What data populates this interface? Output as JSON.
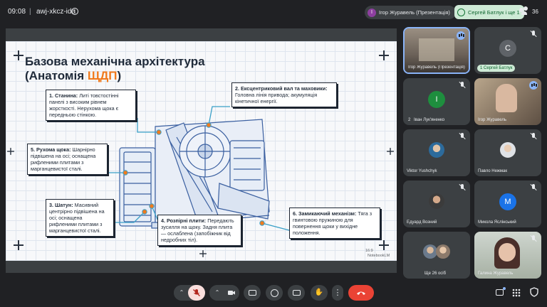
{
  "topbar": {
    "time": "09:08",
    "separator": "|",
    "meeting_code": "awj-xkcz-ida",
    "presenter": {
      "initial": "І",
      "label": "Ігор Журавель (Презентація)"
    },
    "host": {
      "label": "Сергей Батлук і ще 1"
    },
    "participants_count": "36"
  },
  "slide": {
    "title_line1": "Базова механічна архітектура",
    "title_line2_prefix": "(Анатомія ",
    "title_line2_accent": "ЩДП",
    "title_line2_suffix": ")",
    "callouts": [
      {
        "head": "1. Станина:",
        "body": " Литі товстостінні панелі з високим рівнем жорсткості. Нерухома щока є передньою стінкою."
      },
      {
        "head": "2. Ексцентриковий вал та маховики:",
        "body": " Головна лінія привода; акумуляція кінетичної енергії."
      },
      {
        "head": "5. Рухома щока:",
        "body": " Шарнірно підвішена на осі; оснащена рифленими плитами з марганцевистої сталі."
      },
      {
        "head": "3. Шатун:",
        "body": " Масивний центрірно підвішена на осі; оснащена рифленими плитами з марганцевистої сталі."
      },
      {
        "head": "4. Розпірні плити:",
        "body": " Передають зусилля на щоку. Задня плита — ослаблена (запобіжник від недробних тіл)."
      },
      {
        "head": "6. Замикаючий механізм:",
        "body": " Тяга з гвинтовою пружиною для повернення щоки у вихідне положення."
      }
    ],
    "ratio": "16:9",
    "watermark": "NotebookLM"
  },
  "tiles": [
    {
      "name": "Ігор Журавель (Презентація)",
      "type": "screen"
    },
    {
      "name": "Сергей Батлук",
      "initial": "С",
      "badge": "1",
      "color": "#5f6368"
    },
    {
      "name": "Іван Лук'яненко",
      "initial": "І",
      "badge": "2",
      "color": "#1e8e3e"
    },
    {
      "name": "Ігор Журавель",
      "type": "photo"
    },
    {
      "name": "Viktor Yushchyk"
    },
    {
      "name": "Павло Нежмак"
    },
    {
      "name": "Едуард Возний"
    },
    {
      "name": "Микола Яслінський",
      "initial": "M",
      "color": "#1a73e8"
    },
    {
      "name": "Ще 26 осіб"
    },
    {
      "name": "Галина Журавель"
    }
  ],
  "colors": {
    "background": "#202124",
    "tile": "#3c4043",
    "accent_orange": "#f07a1d",
    "leave_red": "#ea4335",
    "mute_pink": "#f9dedc",
    "host_green": "#ceead6"
  },
  "toolbar": {
    "buttons": [
      "chevron-up-icon",
      "mic-off-icon",
      "chevron-up-icon",
      "camera-icon",
      "present-icon",
      "emoji-icon",
      "captions-icon",
      "raise-hand-icon",
      "more-icon",
      "leave-call-icon",
      "chat-icon",
      "apps-icon"
    ]
  }
}
